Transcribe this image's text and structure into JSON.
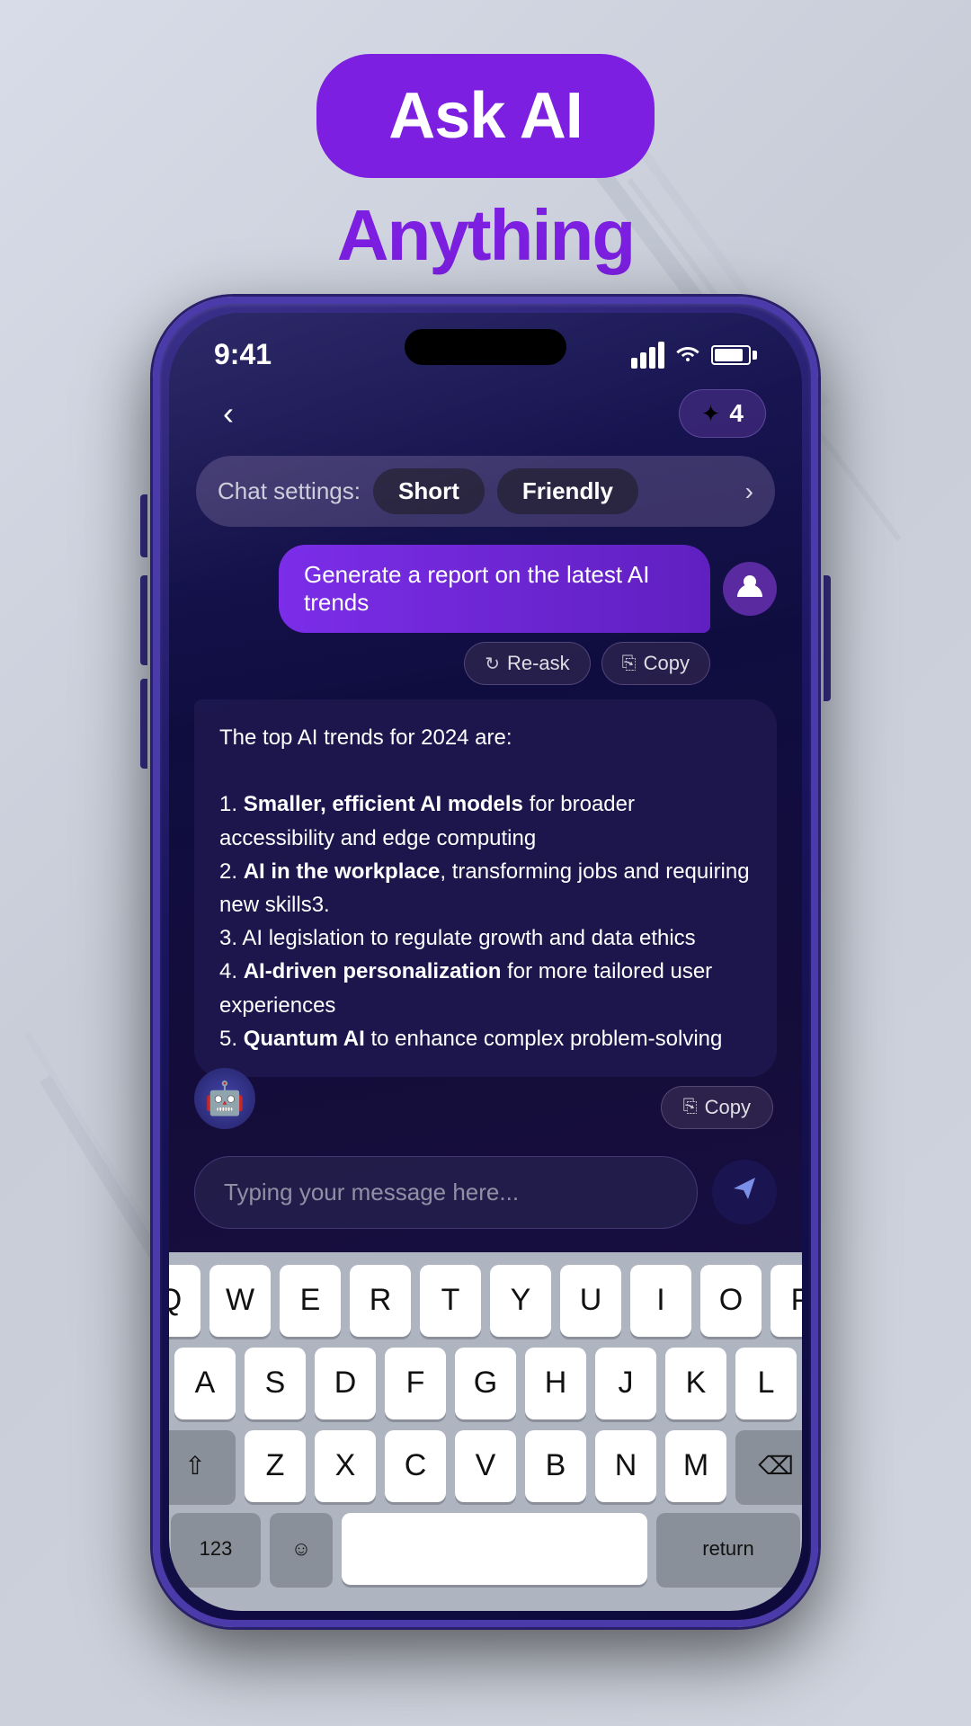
{
  "header": {
    "title_part1": "Ask AI",
    "title_part2": "Anything"
  },
  "phone": {
    "status": {
      "time": "9:41",
      "signal_bars": [
        12,
        18,
        24,
        30
      ],
      "battery_label": "battery"
    },
    "nav": {
      "back_label": "‹",
      "credits_count": "4"
    },
    "chat_settings": {
      "label": "Chat settings:",
      "tag1": "Short",
      "tag2": "Friendly",
      "arrow": "›"
    },
    "user_message": {
      "text": "Generate a report on the latest AI trends",
      "reask_label": "Re-ask",
      "copy_label": "Copy"
    },
    "ai_message": {
      "intro": "The top AI trends for 2024 are:",
      "items": [
        {
          "number": "1.",
          "bold": "Smaller, efficient AI models",
          "rest": " for broader accessibility and edge computing"
        },
        {
          "number": "2.",
          "bold": "AI in the workplace",
          "rest": ", transforming jobs and requiring new skills3."
        },
        {
          "number": "3.",
          "bold": "",
          "rest": "AI legislation to regulate growth and data ethics"
        },
        {
          "number": "4.",
          "bold": "AI-driven personalization",
          "rest": " for more tailored user experiences"
        },
        {
          "number": "5.",
          "bold": "Quantum AI",
          "rest": " to enhance complex problem-solving"
        }
      ],
      "copy_label": "Copy"
    },
    "input": {
      "placeholder": "Typing your message here...",
      "send_icon": "➤"
    },
    "keyboard": {
      "row1": [
        "Q",
        "W",
        "E",
        "R",
        "T",
        "Y",
        "U",
        "I",
        "O",
        "P"
      ],
      "row2": [
        "A",
        "S",
        "D",
        "F",
        "G",
        "H",
        "J",
        "K",
        "L"
      ],
      "row3": [
        "Z",
        "X",
        "C",
        "V",
        "B",
        "N",
        "M"
      ],
      "shift_label": "⇧",
      "delete_label": "⌫"
    }
  }
}
